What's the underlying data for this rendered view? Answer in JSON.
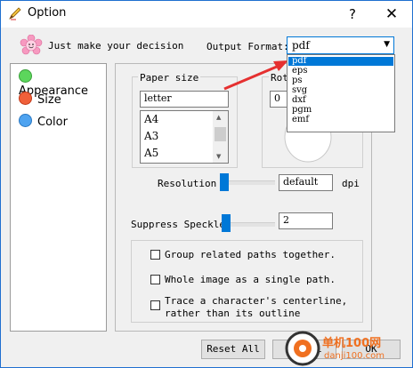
{
  "window": {
    "title": "Option",
    "help_symbol": "?",
    "close_symbol": "✕",
    "app_icon": "pencil-icon"
  },
  "header": {
    "slogan": "Just make your decision",
    "slogan_icon": "flower-smiley-icon",
    "output_format_label": "Output Format:",
    "output_format_value": "pdf",
    "output_format_options": [
      "pdf",
      "eps",
      "ps",
      "svg",
      "dxf",
      "pgm",
      "emf"
    ]
  },
  "nav": {
    "items": [
      {
        "label": "Appearance",
        "color": "#5cd65c"
      },
      {
        "label": "Size",
        "color": "#f0603a"
      },
      {
        "label": "Color",
        "color": "#4ea3f0"
      }
    ]
  },
  "paper_size": {
    "title": "Paper size",
    "value": "letter",
    "options": [
      "A4",
      "A3",
      "A5"
    ]
  },
  "rotate": {
    "title": "Rot",
    "value": "0"
  },
  "resolution": {
    "label": "Resolution",
    "value": "default",
    "unit": "dpi",
    "slider_level": 0.02
  },
  "suppress_speckle": {
    "label": "Suppress Speckle:",
    "value": "2",
    "slider_level": 0.0
  },
  "options": [
    {
      "label": "Group related paths together.",
      "checked": false
    },
    {
      "label": "Whole image as a single path.",
      "checked": false
    },
    {
      "label_line1": "Trace a character's centerline,",
      "label_line2": "rather than its outline",
      "checked": false
    }
  ],
  "buttons": {
    "reset_all": "Reset All",
    "cancel": "Cancel",
    "ok": "OK"
  },
  "annotation": {
    "arrow_color": "#e53030"
  },
  "watermark": {
    "line1": "单机100网",
    "line2": "danji100.com"
  }
}
